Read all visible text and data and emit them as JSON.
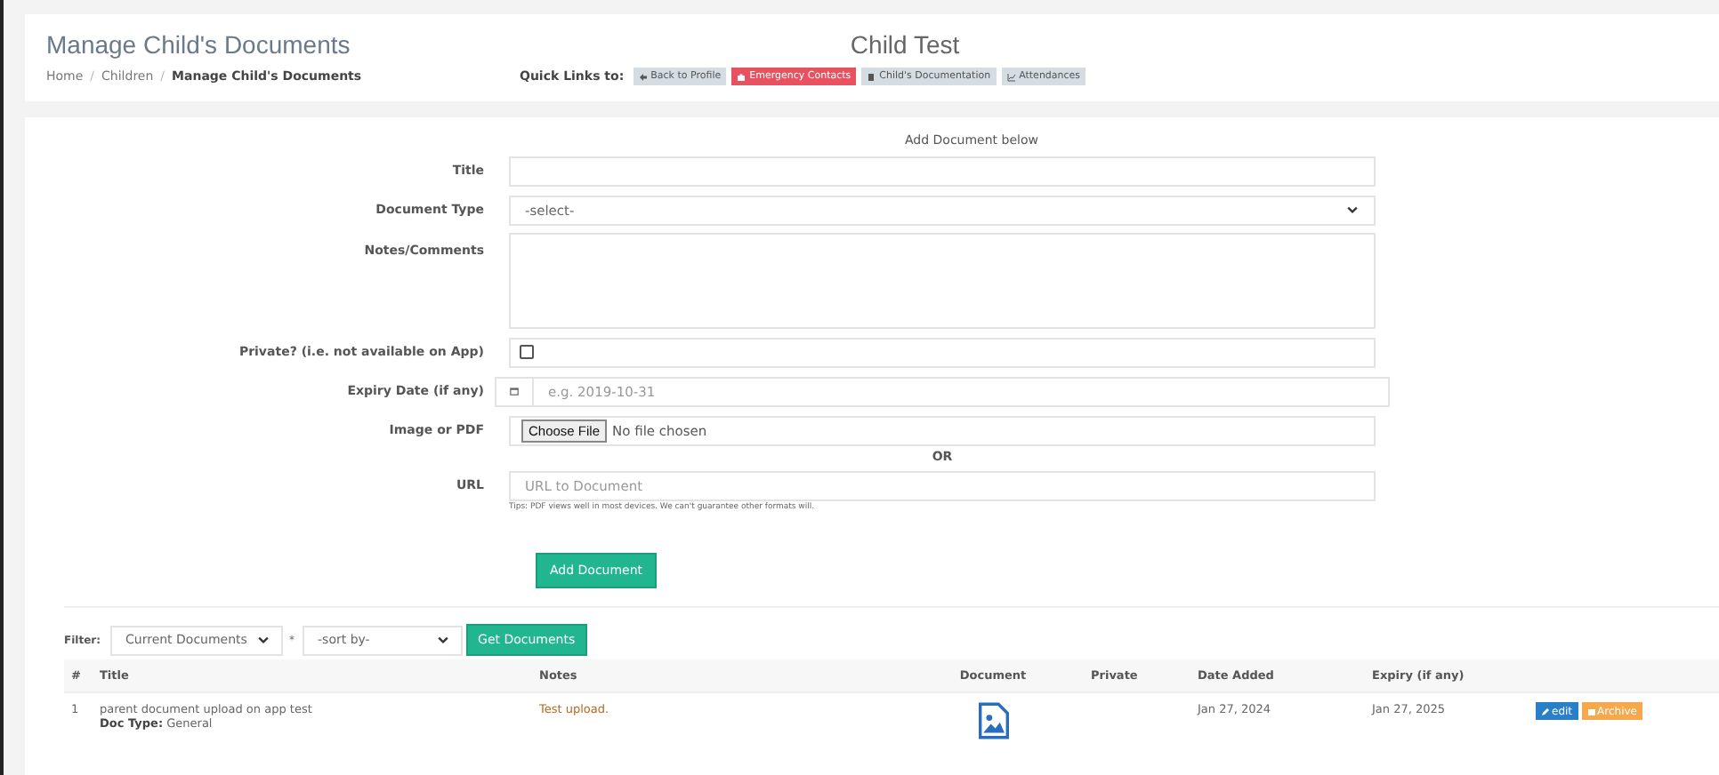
{
  "header": {
    "title": "Manage Child's Documents",
    "child_name": "Child Test",
    "breadcrumb_separator": "/",
    "breadcrumb": [
      {
        "label": "Home",
        "current": false
      },
      {
        "label": "Children",
        "current": false
      },
      {
        "label": "Manage Child's Documents",
        "current": true
      }
    ],
    "quick_links_label": "Quick Links to:",
    "quick_links": [
      {
        "label": "Back to Profile",
        "kind": "back"
      },
      {
        "label": "Emergency Contacts",
        "kind": "emergency"
      },
      {
        "label": "Child's Documentation",
        "kind": "docs"
      },
      {
        "label": "Attendances",
        "kind": "attend"
      }
    ]
  },
  "form": {
    "heading": "Add Document below",
    "fields": [
      {
        "kind": "text",
        "label": "Title"
      },
      {
        "kind": "select",
        "label": "Document Type",
        "value": "-select-"
      },
      {
        "kind": "textarea",
        "label": "Notes/Comments"
      },
      {
        "kind": "checkbox",
        "label": "Private? (i.e. not available on App)",
        "checked": false
      },
      {
        "kind": "date",
        "label": "Expiry Date (if any)",
        "placeholder": "e.g. 2019-10-31"
      },
      {
        "kind": "file",
        "label": "Image or PDF",
        "button": "Choose File",
        "value": "No file chosen"
      },
      {
        "kind": "or",
        "label": "OR"
      },
      {
        "kind": "url",
        "label": "URL",
        "placeholder": "URL to Document",
        "hint": "Tips: PDF views well in most devices. We can't guarantee other formats will."
      }
    ],
    "submit": "Add Document"
  },
  "filter": {
    "label": "Filter:",
    "status": "Current Documents",
    "separator": "*",
    "sort": "-sort by-",
    "button": "Get Documents"
  },
  "table": {
    "columns": [
      "#",
      "Title",
      "Notes",
      "Document",
      "Private",
      "Date Added",
      "Expiry (if any)"
    ],
    "rows": [
      {
        "index": "1",
        "title": "parent document upload on app test",
        "doc_type_label": "Doc Type:",
        "doc_type": "General",
        "notes": "Test upload.",
        "date_added": "Jan 27, 2024",
        "expiry": "Jan 27, 2025",
        "actions": [
          "edit",
          "Archive"
        ]
      }
    ]
  }
}
